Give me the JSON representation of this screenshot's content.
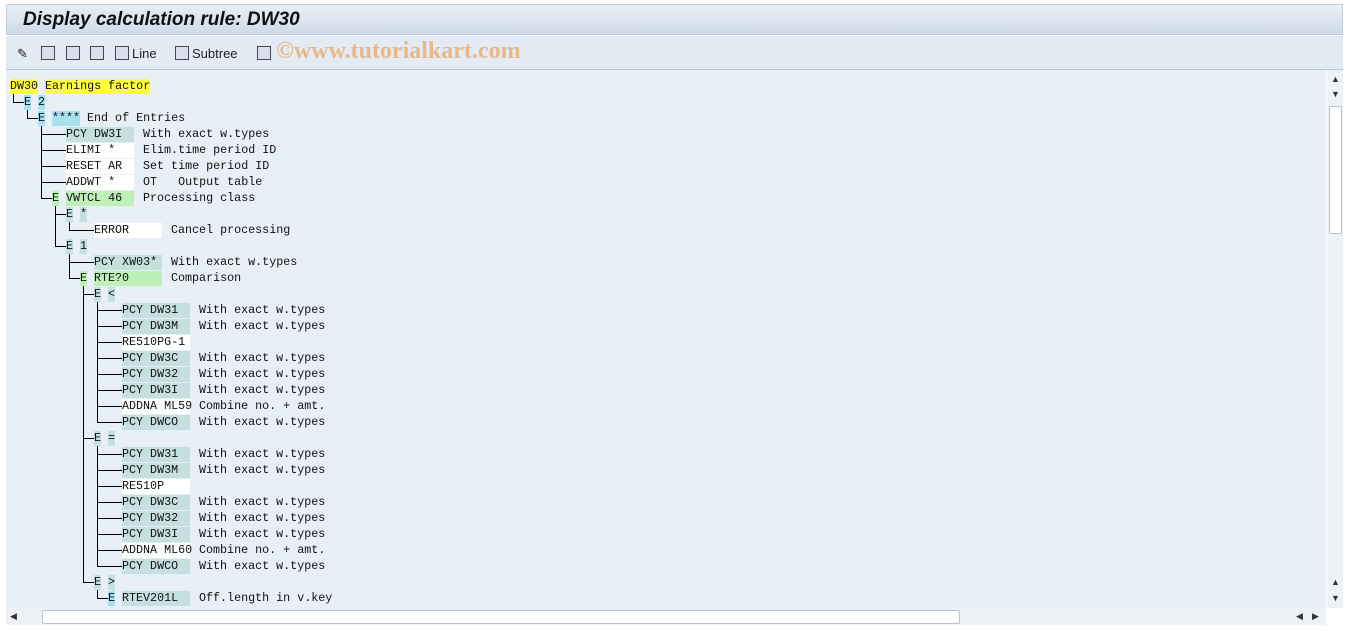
{
  "title": "Display calculation rule: DW30",
  "toolbar": {
    "line": "Line",
    "subtree": "Subtree",
    "watermark": "©www.tutorialkart.com"
  },
  "rows": [
    {
      "d": 0,
      "t": "root",
      "k": "DW30",
      "desc": "Earnings factor",
      "c": "hl"
    },
    {
      "d": 1,
      "t": "node",
      "k": "2",
      "c": "cy"
    },
    {
      "d": 2,
      "t": "node",
      "k": "****",
      "desc": "End of Entries",
      "c": "cy"
    },
    {
      "d": 3,
      "t": "leaf",
      "k": "PCY DW3I",
      "desc": "With exact w.types",
      "c": "tl"
    },
    {
      "d": 3,
      "t": "leaf",
      "k": "ELIMI *",
      "desc": "Elim.time period ID",
      "c": "wh"
    },
    {
      "d": 3,
      "t": "leaf",
      "k": "RESET AR",
      "desc": "Set time period ID",
      "c": "wh"
    },
    {
      "d": 3,
      "t": "leaf",
      "k": "ADDWT *",
      "desc": "OT   Output table",
      "c": "wh"
    },
    {
      "d": 3,
      "t": "node",
      "k": "VWTCL 46",
      "desc": "Processing class",
      "c": "gr",
      "box": 1
    },
    {
      "d": 4,
      "t": "node",
      "k": "*",
      "c": "tl"
    },
    {
      "d": 5,
      "t": "leaf",
      "k": "ERROR",
      "desc": "Cancel processing",
      "c": "wh"
    },
    {
      "d": 4,
      "t": "node",
      "k": "1",
      "c": "tl"
    },
    {
      "d": 5,
      "t": "leaf",
      "k": "PCY XW03*",
      "desc": "With exact w.types",
      "c": "tl"
    },
    {
      "d": 5,
      "t": "node",
      "k": "RTE?0",
      "desc": "Comparison",
      "c": "gr",
      "box": 1
    },
    {
      "d": 6,
      "t": "node",
      "k": "<",
      "c": "tl"
    },
    {
      "d": 7,
      "t": "leaf",
      "k": "PCY DW31",
      "desc": "With exact w.types",
      "c": "tl"
    },
    {
      "d": 7,
      "t": "leaf",
      "k": "PCY DW3M",
      "desc": "With exact w.types",
      "c": "tl"
    },
    {
      "d": 7,
      "t": "leaf",
      "k": "RE510PG-1",
      "desc": "",
      "c": "wh"
    },
    {
      "d": 7,
      "t": "leaf",
      "k": "PCY DW3C",
      "desc": "With exact w.types",
      "c": "tl"
    },
    {
      "d": 7,
      "t": "leaf",
      "k": "PCY DW32",
      "desc": "With exact w.types",
      "c": "tl"
    },
    {
      "d": 7,
      "t": "leaf",
      "k": "PCY DW3I",
      "desc": "With exact w.types",
      "c": "tl"
    },
    {
      "d": 7,
      "t": "leaf",
      "k": "ADDNA ML59",
      "desc": "Combine no. + amt.",
      "c": "wh"
    },
    {
      "d": 7,
      "t": "leaf",
      "k": "PCY DWCO",
      "desc": "With exact w.types",
      "c": "tl"
    },
    {
      "d": 6,
      "t": "node",
      "k": "=",
      "c": "tl"
    },
    {
      "d": 7,
      "t": "leaf",
      "k": "PCY DW31",
      "desc": "With exact w.types",
      "c": "tl"
    },
    {
      "d": 7,
      "t": "leaf",
      "k": "PCY DW3M",
      "desc": "With exact w.types",
      "c": "tl"
    },
    {
      "d": 7,
      "t": "leaf",
      "k": "RE510P",
      "desc": "",
      "c": "wh"
    },
    {
      "d": 7,
      "t": "leaf",
      "k": "PCY DW3C",
      "desc": "With exact w.types",
      "c": "tl"
    },
    {
      "d": 7,
      "t": "leaf",
      "k": "PCY DW32",
      "desc": "With exact w.types",
      "c": "tl"
    },
    {
      "d": 7,
      "t": "leaf",
      "k": "PCY DW3I",
      "desc": "With exact w.types",
      "c": "tl"
    },
    {
      "d": 7,
      "t": "leaf",
      "k": "ADDNA ML60",
      "desc": "Combine no. + amt.",
      "c": "wh"
    },
    {
      "d": 7,
      "t": "leaf",
      "k": "PCY DWCO",
      "desc": "With exact w.types",
      "c": "tl"
    },
    {
      "d": 6,
      "t": "node",
      "k": ">",
      "c": "tl"
    },
    {
      "d": 7,
      "t": "node",
      "k": "RTEV201L",
      "desc": "Off.length in v.key",
      "c": "tl",
      "box": 1
    }
  ]
}
